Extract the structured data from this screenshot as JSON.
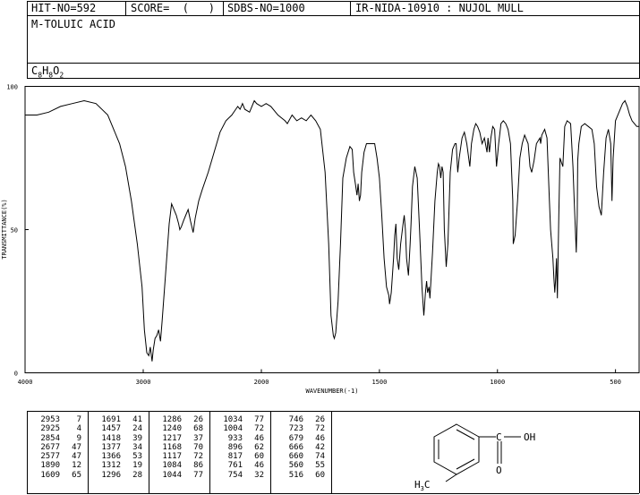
{
  "header": {
    "hit_no": "HIT-NO=592",
    "score": "SCORE=  (   )",
    "sdbs_no": "SDBS-NO=1000",
    "ir_nida": "IR-NIDA-10910 : NUJOL MULL",
    "compound": "M-TOLUIC ACID",
    "formula_prefix": "C",
    "formula_c": "8",
    "formula_h": "H",
    "formula_hn": "8",
    "formula_o": "O",
    "formula_on": "2"
  },
  "chart_data": {
    "type": "line",
    "title": "",
    "xlabel": "WAVENUMBER(-1)",
    "ylabel": "TRANSMITTANCE(%)",
    "xlim": [
      4000,
      400
    ],
    "ylim": [
      0,
      100
    ],
    "x_ticks": [
      "4000",
      "3000",
      "2000",
      "1500",
      "1000",
      "500"
    ],
    "y_ticks": [
      "100",
      "50",
      "0"
    ],
    "series": [
      {
        "points": [
          [
            4000,
            90
          ],
          [
            3900,
            90
          ],
          [
            3800,
            91
          ],
          [
            3700,
            93
          ],
          [
            3600,
            94
          ],
          [
            3500,
            95
          ],
          [
            3400,
            94
          ],
          [
            3300,
            90
          ],
          [
            3200,
            80
          ],
          [
            3150,
            72
          ],
          [
            3100,
            60
          ],
          [
            3050,
            45
          ],
          [
            3010,
            30
          ],
          [
            2990,
            15
          ],
          [
            2970,
            7
          ],
          [
            2953,
            6
          ],
          [
            2940,
            9
          ],
          [
            2925,
            4
          ],
          [
            2915,
            8
          ],
          [
            2900,
            12
          ],
          [
            2885,
            13
          ],
          [
            2870,
            15
          ],
          [
            2854,
            11
          ],
          [
            2840,
            18
          ],
          [
            2810,
            35
          ],
          [
            2780,
            52
          ],
          [
            2760,
            59
          ],
          [
            2740,
            57
          ],
          [
            2720,
            55
          ],
          [
            2700,
            52
          ],
          [
            2690,
            50
          ],
          [
            2677,
            51
          ],
          [
            2660,
            53
          ],
          [
            2640,
            55
          ],
          [
            2620,
            57
          ],
          [
            2600,
            53
          ],
          [
            2577,
            49
          ],
          [
            2560,
            54
          ],
          [
            2530,
            60
          ],
          [
            2500,
            64
          ],
          [
            2450,
            70
          ],
          [
            2400,
            77
          ],
          [
            2350,
            84
          ],
          [
            2300,
            88
          ],
          [
            2250,
            90
          ],
          [
            2200,
            93
          ],
          [
            2180,
            92
          ],
          [
            2160,
            94
          ],
          [
            2140,
            92
          ],
          [
            2100,
            91
          ],
          [
            2060,
            95
          ],
          [
            2040,
            94
          ],
          [
            2000,
            93
          ],
          [
            1980,
            94
          ],
          [
            1960,
            93
          ],
          [
            1930,
            90
          ],
          [
            1900,
            88
          ],
          [
            1890,
            87
          ],
          [
            1870,
            90
          ],
          [
            1850,
            88
          ],
          [
            1830,
            89
          ],
          [
            1810,
            88
          ],
          [
            1790,
            90
          ],
          [
            1770,
            88
          ],
          [
            1750,
            85
          ],
          [
            1730,
            70
          ],
          [
            1715,
            45
          ],
          [
            1705,
            20
          ],
          [
            1695,
            13
          ],
          [
            1691,
            12
          ],
          [
            1685,
            14
          ],
          [
            1675,
            25
          ],
          [
            1665,
            45
          ],
          [
            1655,
            68
          ],
          [
            1640,
            75
          ],
          [
            1625,
            79
          ],
          [
            1615,
            78
          ],
          [
            1609,
            70
          ],
          [
            1600,
            65
          ],
          [
            1595,
            62
          ],
          [
            1590,
            66
          ],
          [
            1585,
            60
          ],
          [
            1580,
            62
          ],
          [
            1575,
            70
          ],
          [
            1565,
            77
          ],
          [
            1555,
            80
          ],
          [
            1540,
            80
          ],
          [
            1530,
            80
          ],
          [
            1520,
            80
          ],
          [
            1510,
            75
          ],
          [
            1500,
            68
          ],
          [
            1490,
            55
          ],
          [
            1480,
            40
          ],
          [
            1470,
            30
          ],
          [
            1460,
            27
          ],
          [
            1457,
            24
          ],
          [
            1450,
            28
          ],
          [
            1440,
            40
          ],
          [
            1435,
            48
          ],
          [
            1430,
            52
          ],
          [
            1425,
            40
          ],
          [
            1418,
            36
          ],
          [
            1410,
            45
          ],
          [
            1400,
            52
          ],
          [
            1395,
            55
          ],
          [
            1390,
            50
          ],
          [
            1385,
            40
          ],
          [
            1377,
            34
          ],
          [
            1370,
            45
          ],
          [
            1366,
            52
          ],
          [
            1360,
            65
          ],
          [
            1350,
            72
          ],
          [
            1340,
            68
          ],
          [
            1330,
            50
          ],
          [
            1320,
            30
          ],
          [
            1312,
            20
          ],
          [
            1305,
            28
          ],
          [
            1300,
            32
          ],
          [
            1296,
            28
          ],
          [
            1290,
            30
          ],
          [
            1286,
            26
          ],
          [
            1282,
            32
          ],
          [
            1275,
            42
          ],
          [
            1265,
            60
          ],
          [
            1255,
            70
          ],
          [
            1250,
            73
          ],
          [
            1245,
            72
          ],
          [
            1240,
            68
          ],
          [
            1235,
            72
          ],
          [
            1230,
            70
          ],
          [
            1225,
            50
          ],
          [
            1217,
            37
          ],
          [
            1210,
            45
          ],
          [
            1200,
            70
          ],
          [
            1190,
            78
          ],
          [
            1180,
            80
          ],
          [
            1175,
            80
          ],
          [
            1168,
            70
          ],
          [
            1162,
            75
          ],
          [
            1150,
            82
          ],
          [
            1140,
            84
          ],
          [
            1130,
            80
          ],
          [
            1117,
            72
          ],
          [
            1110,
            80
          ],
          [
            1100,
            85
          ],
          [
            1092,
            87
          ],
          [
            1084,
            86
          ],
          [
            1075,
            84
          ],
          [
            1065,
            80
          ],
          [
            1055,
            82
          ],
          [
            1044,
            77
          ],
          [
            1040,
            82
          ],
          [
            1034,
            77
          ],
          [
            1028,
            82
          ],
          [
            1020,
            86
          ],
          [
            1012,
            85
          ],
          [
            1004,
            72
          ],
          [
            995,
            80
          ],
          [
            985,
            87
          ],
          [
            975,
            88
          ],
          [
            965,
            87
          ],
          [
            955,
            85
          ],
          [
            945,
            80
          ],
          [
            935,
            60
          ],
          [
            933,
            45
          ],
          [
            925,
            48
          ],
          [
            915,
            60
          ],
          [
            905,
            75
          ],
          [
            895,
            80
          ],
          [
            885,
            83
          ],
          [
            870,
            80
          ],
          [
            862,
            72
          ],
          [
            855,
            70
          ],
          [
            845,
            74
          ],
          [
            835,
            80
          ],
          [
            820,
            82
          ],
          [
            817,
            80
          ],
          [
            812,
            83
          ],
          [
            800,
            85
          ],
          [
            790,
            82
          ],
          [
            780,
            60
          ],
          [
            775,
            50
          ],
          [
            770,
            45
          ],
          [
            765,
            40
          ],
          [
            761,
            33
          ],
          [
            757,
            28
          ],
          [
            754,
            32
          ],
          [
            750,
            40
          ],
          [
            746,
            26
          ],
          [
            740,
            55
          ],
          [
            735,
            75
          ],
          [
            723,
            72
          ],
          [
            715,
            86
          ],
          [
            705,
            88
          ],
          [
            690,
            87
          ],
          [
            680,
            72
          ],
          [
            675,
            60
          ],
          [
            670,
            50
          ],
          [
            666,
            42
          ],
          [
            662,
            55
          ],
          [
            660,
            74
          ],
          [
            655,
            80
          ],
          [
            645,
            86
          ],
          [
            630,
            87
          ],
          [
            615,
            86
          ],
          [
            600,
            85
          ],
          [
            590,
            80
          ],
          [
            580,
            65
          ],
          [
            570,
            58
          ],
          [
            560,
            55
          ],
          [
            550,
            70
          ],
          [
            540,
            82
          ],
          [
            530,
            85
          ],
          [
            520,
            80
          ],
          [
            515,
            60
          ],
          [
            510,
            75
          ],
          [
            500,
            88
          ],
          [
            480,
            92
          ],
          [
            470,
            94
          ],
          [
            460,
            95
          ],
          [
            450,
            93
          ],
          [
            440,
            90
          ],
          [
            430,
            88
          ],
          [
            420,
            87
          ],
          [
            410,
            86
          ],
          [
            400,
            86
          ]
        ]
      }
    ]
  },
  "peaks": {
    "col1": [
      [
        "2953",
        "7"
      ],
      [
        "2925",
        "4"
      ],
      [
        "2854",
        "9"
      ],
      [
        "2677",
        "47"
      ],
      [
        "2577",
        "47"
      ],
      [
        "1890",
        "12"
      ],
      [
        "1609",
        "65"
      ]
    ],
    "col2": [
      [
        "1691",
        "41"
      ],
      [
        "1457",
        "24"
      ],
      [
        "1418",
        "39"
      ],
      [
        "1377",
        "34"
      ],
      [
        "1366",
        "53"
      ],
      [
        "1312",
        "19"
      ],
      [
        "1296",
        "28"
      ]
    ],
    "col3": [
      [
        "1286",
        "26"
      ],
      [
        "1240",
        "68"
      ],
      [
        "1217",
        "37"
      ],
      [
        "1168",
        "70"
      ],
      [
        "1117",
        "72"
      ],
      [
        "1084",
        "86"
      ],
      [
        "1044",
        "77"
      ]
    ],
    "col4": [
      [
        "1034",
        "77"
      ],
      [
        "1004",
        "72"
      ],
      [
        "933",
        "46"
      ],
      [
        "896",
        "62"
      ],
      [
        "817",
        "60"
      ],
      [
        "761",
        "46"
      ],
      [
        "754",
        "32"
      ]
    ],
    "col5": [
      [
        "746",
        "26"
      ],
      [
        "723",
        "72"
      ],
      [
        "679",
        "46"
      ],
      [
        "666",
        "42"
      ],
      [
        "660",
        "74"
      ],
      [
        "560",
        "55"
      ],
      [
        "516",
        "60"
      ]
    ]
  },
  "structure": {
    "label_cooh_c": "C",
    "label_oh": "OH",
    "label_o": "O",
    "label_h": "H",
    "label_3": "3",
    "label_c": "C"
  }
}
